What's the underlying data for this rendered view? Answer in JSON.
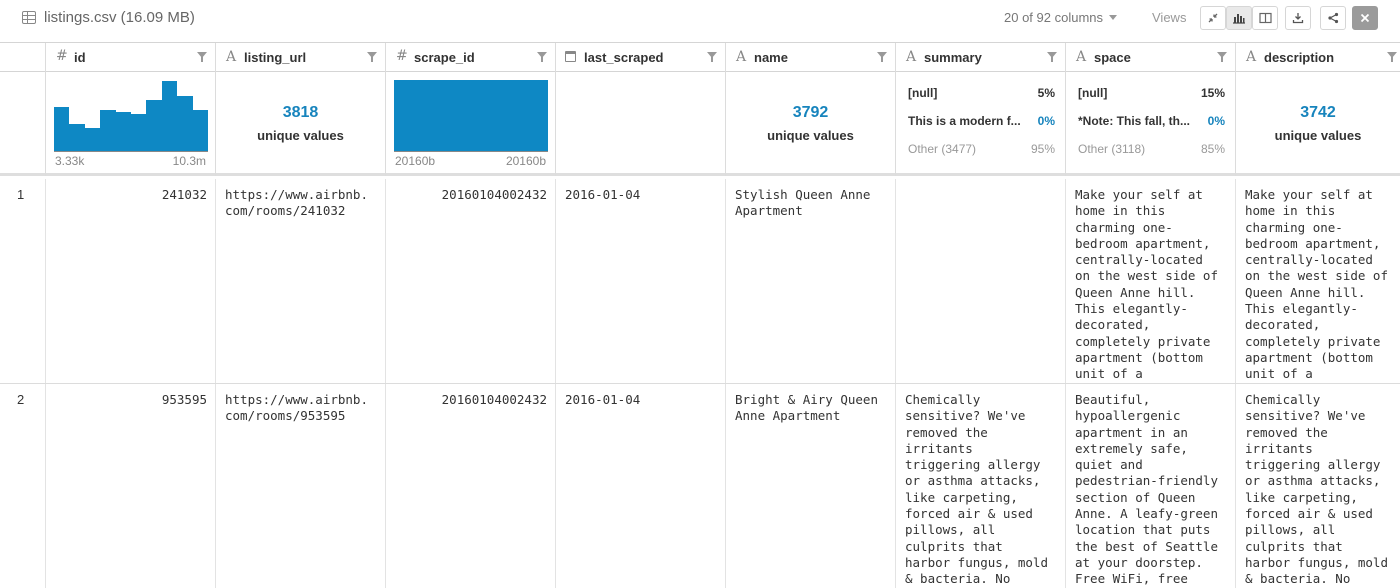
{
  "file": {
    "title": "listings.csv (16.09 MB)"
  },
  "toolbar": {
    "columns_label": "20 of 92 columns",
    "views_label": "Views"
  },
  "columns": [
    {
      "name": "id",
      "type": "number"
    },
    {
      "name": "listing_url",
      "type": "text"
    },
    {
      "name": "scrape_id",
      "type": "number"
    },
    {
      "name": "last_scraped",
      "type": "date"
    },
    {
      "name": "name",
      "type": "text"
    },
    {
      "name": "summary",
      "type": "text"
    },
    {
      "name": "space",
      "type": "text"
    },
    {
      "name": "description",
      "type": "text"
    }
  ],
  "summaries": {
    "id": {
      "hist_values": [
        0.62,
        0.38,
        0.32,
        0.58,
        0.55,
        0.52,
        0.72,
        0.98,
        0.77,
        0.58
      ],
      "min": "3.33k",
      "max": "10.3m"
    },
    "listing_url": {
      "unique": "3818",
      "label": "unique values"
    },
    "scrape_id": {
      "hist_values": [
        1.0
      ],
      "min": "20160b",
      "max": "20160b"
    },
    "name": {
      "unique": "3792",
      "label": "unique values"
    },
    "summary": {
      "top": [
        {
          "value": "[null]",
          "pct": "5%"
        },
        {
          "value": "This is a modern f...",
          "pct": "0%"
        },
        {
          "value": "Other (3477)",
          "pct": "95%"
        }
      ]
    },
    "space": {
      "top": [
        {
          "value": "[null]",
          "pct": "15%"
        },
        {
          "value": "*Note: This fall, th...",
          "pct": "0%"
        },
        {
          "value": "Other (3118)",
          "pct": "85%"
        }
      ]
    },
    "description": {
      "unique": "3742",
      "label": "unique values"
    }
  },
  "rows": [
    {
      "index": "1",
      "id": "241032",
      "listing_url": "https://www.airbnb.com/rooms/241032",
      "scrape_id": "20160104002432",
      "last_scraped": "2016-01-04",
      "name": "Stylish Queen Anne Apartment",
      "summary": "",
      "space": "Make your self at home in this charming one-bedroom apartment, centrally-located on the west side of Queen Anne hill. This elegantly-decorated, completely private apartment (bottom unit of a duplex)...",
      "description": "Make your self at home in this charming one-bedroom apartment, centrally-located on the west side of Queen Anne hill. This elegantly-decorated, completely private apartment (bottom unit of a duplex)..."
    },
    {
      "index": "2",
      "id": "953595",
      "listing_url": "https://www.airbnb.com/rooms/953595",
      "scrape_id": "20160104002432",
      "last_scraped": "2016-01-04",
      "name": "Bright & Airy Queen Anne Apartment",
      "summary": "Chemically sensitive? We've removed the irritants triggering allergy or asthma attacks, like carpeting, forced air & used pillows, all culprits that harbor fungus, mold & bacteria. No smoking, no pet...",
      "space": "Beautiful, hypoallergenic apartment in an extremely safe, quiet and pedestrian-friendly section of Queen Anne. A leafy-green location that puts the best of Seattle at your doorstep. Free WiFi, free p...",
      "description": "Chemically sensitive? We've removed the irritants triggering allergy or asthma attacks, like carpeting, forced air & used pillows, all culprits that harbor fungus, mold & bacteria. No smoking, no pet..."
    }
  ]
}
